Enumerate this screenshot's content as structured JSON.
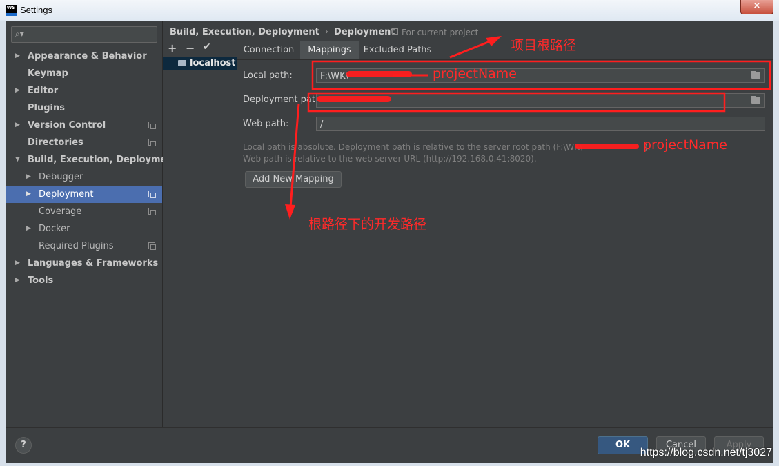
{
  "window": {
    "logo": "WS",
    "title": "Settings",
    "close_glyph": "×"
  },
  "search": {
    "placeholder": ""
  },
  "sidebar": {
    "items": [
      {
        "label": "Appearance & Behavior",
        "bold": true,
        "arrow": "right"
      },
      {
        "label": "Keymap",
        "bold": true
      },
      {
        "label": "Editor",
        "bold": true,
        "arrow": "right"
      },
      {
        "label": "Plugins",
        "bold": true
      },
      {
        "label": "Version Control",
        "bold": true,
        "arrow": "right",
        "project_icon": true
      },
      {
        "label": "Directories",
        "bold": true,
        "project_icon": true
      },
      {
        "label": "Build, Execution, Deployment",
        "bold": true,
        "arrow": "down"
      },
      {
        "label": "Debugger",
        "arrow": "right"
      },
      {
        "label": "Deployment",
        "arrow": "right",
        "project_icon": true,
        "selected": true
      },
      {
        "label": "Coverage",
        "project_icon": true
      },
      {
        "label": "Docker",
        "arrow": "right"
      },
      {
        "label": "Required Plugins",
        "project_icon": true
      },
      {
        "label": "Languages & Frameworks",
        "bold": true,
        "arrow": "right"
      },
      {
        "label": "Tools",
        "bold": true,
        "arrow": "right"
      }
    ]
  },
  "breadcrumb": {
    "parent": "Build, Execution, Deployment",
    "separator": "›",
    "current": "Deployment"
  },
  "scope_note": "For current project",
  "server_toolbar": {
    "add": "+",
    "remove": "−",
    "set_default": "✔"
  },
  "servers": [
    {
      "label": "localhost",
      "selected": true
    }
  ],
  "tabs": [
    {
      "label": "Connection"
    },
    {
      "label": "Mappings",
      "active": true
    },
    {
      "label": "Excluded Paths"
    }
  ],
  "mappings": {
    "local_path": {
      "label": "Local path:",
      "value": "F:\\WK\\"
    },
    "deployment_path": {
      "label": "Deployment path:",
      "value": ""
    },
    "web_path": {
      "label": "Web path:",
      "value": "/"
    },
    "hint_line1": "Local path is absolute. Deployment path is relative to the server root path (F:\\WK\\",
    "hint_line1_end": ").",
    "hint_line2": "Web path is relative to the web server URL (http://192.168.0.41:8020).",
    "add_button": "Add New Mapping"
  },
  "footer": {
    "help": "?",
    "ok": "OK",
    "cancel": "Cancel",
    "apply": "Apply"
  },
  "watermark": "https://blog.csdn.net/tj3027",
  "annotations": {
    "project_root": "项目根路径",
    "project_name_1": "projectName",
    "project_name_2": "projectName",
    "dev_path": "根路径下的开发路径"
  },
  "colors": {
    "annotation": "#ff2a2a",
    "selection": "#4b6eaf",
    "ok_button": "#365880"
  }
}
